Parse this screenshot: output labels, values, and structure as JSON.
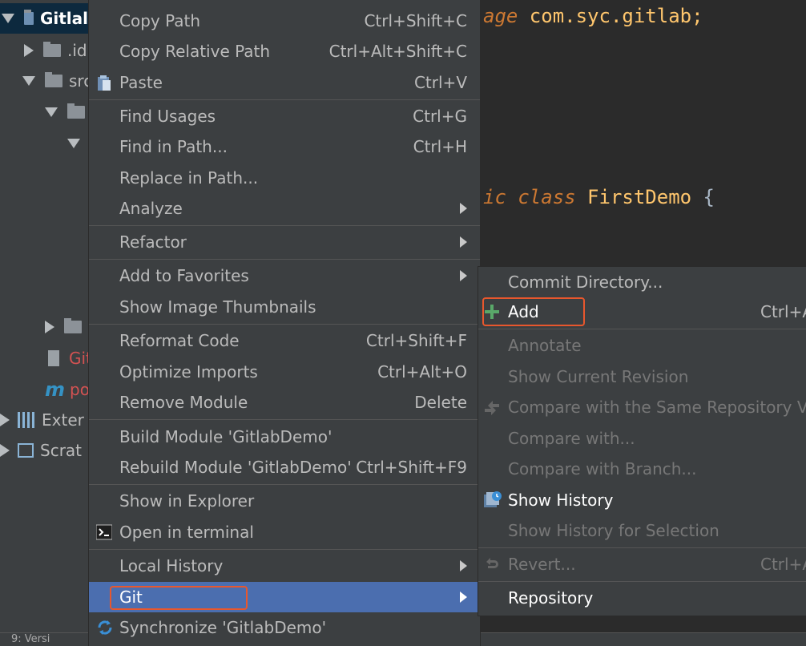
{
  "tree": {
    "root_label": "Gitlal",
    "items": [
      {
        "label": ".id"
      },
      {
        "label": "src"
      },
      {
        "label": "Git"
      },
      {
        "label": "po"
      },
      {
        "label": "Exter"
      },
      {
        "label": "Scrat"
      }
    ]
  },
  "editor": {
    "line1_kw": "age",
    "line1_rest": " com.syc.gitlab;",
    "line2_kw": "ic class",
    "line2_cls": " FirstDemo",
    "line2_brace": " {"
  },
  "statusbar": {
    "text": "9: Versi"
  },
  "menu": {
    "items": [
      {
        "label": "Copy Path",
        "shortcut": "Ctrl+Shift+C"
      },
      {
        "label": "Copy Relative Path",
        "shortcut": "Ctrl+Alt+Shift+C"
      },
      {
        "label": "Paste",
        "shortcut": "Ctrl+V"
      },
      {
        "label": "Find Usages",
        "shortcut": "Ctrl+G"
      },
      {
        "label": "Find in Path...",
        "shortcut": "Ctrl+H"
      },
      {
        "label": "Replace in Path...",
        "shortcut": ""
      },
      {
        "label": "Analyze",
        "shortcut": ""
      },
      {
        "label": "Refactor",
        "shortcut": ""
      },
      {
        "label": "Add to Favorites",
        "shortcut": ""
      },
      {
        "label": "Show Image Thumbnails",
        "shortcut": ""
      },
      {
        "label": "Reformat Code",
        "shortcut": "Ctrl+Shift+F"
      },
      {
        "label": "Optimize Imports",
        "shortcut": "Ctrl+Alt+O"
      },
      {
        "label": "Remove Module",
        "shortcut": "Delete"
      },
      {
        "label": "Build Module 'GitlabDemo'",
        "shortcut": ""
      },
      {
        "label": "Rebuild Module 'GitlabDemo'",
        "shortcut": "Ctrl+Shift+F9"
      },
      {
        "label": "Show in Explorer",
        "shortcut": ""
      },
      {
        "label": "Open in terminal",
        "shortcut": ""
      },
      {
        "label": "Local History",
        "shortcut": ""
      },
      {
        "label": "Git",
        "shortcut": ""
      },
      {
        "label": "Synchronize 'GitlabDemo'",
        "shortcut": ""
      }
    ]
  },
  "submenu": {
    "items": [
      {
        "label": "Commit Directory...",
        "shortcut": ""
      },
      {
        "label": "Add",
        "shortcut": "Ctrl+A"
      },
      {
        "label": "Annotate",
        "shortcut": ""
      },
      {
        "label": "Show Current Revision",
        "shortcut": ""
      },
      {
        "label": "Compare with the Same Repository Ver",
        "shortcut": ""
      },
      {
        "label": "Compare with...",
        "shortcut": ""
      },
      {
        "label": "Compare with Branch...",
        "shortcut": ""
      },
      {
        "label": "Show History",
        "shortcut": ""
      },
      {
        "label": "Show History for Selection",
        "shortcut": ""
      },
      {
        "label": "Revert...",
        "shortcut": "Ctrl+A"
      },
      {
        "label": "Repository",
        "shortcut": ""
      }
    ]
  },
  "colors": {
    "highlight_box": "#e8572d",
    "active_row": "#4b6eaf",
    "add_icon": "#59a869"
  }
}
